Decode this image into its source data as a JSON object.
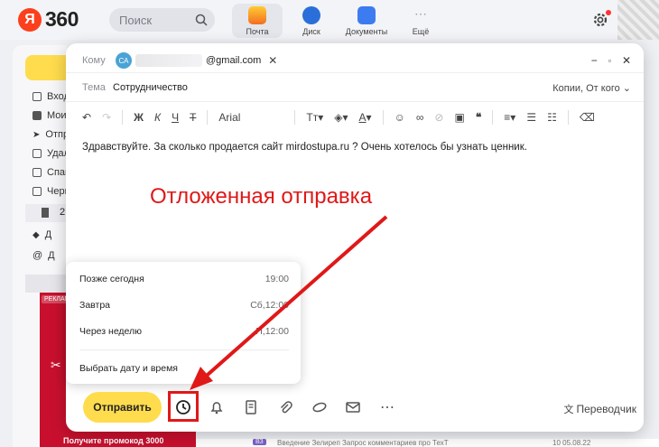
{
  "header": {
    "logo_ya": "Я",
    "logo_360": "360",
    "search_placeholder": "Поиск",
    "apps": [
      {
        "label": "Почта",
        "color": "#f6a123"
      },
      {
        "label": "Диск",
        "color": "#2a6fd9"
      },
      {
        "label": "Документы",
        "color": "#3d7cf0"
      },
      {
        "label": "Ещё",
        "color": "#9aa0aa"
      }
    ],
    "icons": {
      "search": "search-icon",
      "settings": "gear-icon"
    }
  },
  "sidebar": {
    "items": [
      "Вход",
      "Мои",
      "Отпр",
      "Удал",
      "Спам",
      "Черн"
    ],
    "folder_count": "2",
    "labels": [
      "Д",
      "Д"
    ],
    "ad_label": "РЕКЛАМА",
    "ad_text": "Получите промокод 3000"
  },
  "compose": {
    "to_label": "Кому",
    "recipient_initials": "СА",
    "recipient_email": "@gmail.com",
    "subject_label": "Тема",
    "subject": "Сотрудничество",
    "copies": "Копии, От кого",
    "font": "Arial",
    "body": "Здравствуйте. За сколько продается сайт mirdostupa.ru ? Очень хотелось бы узнать ценник.",
    "send_label": "Отправить",
    "translator_label": "Переводчик"
  },
  "schedule": {
    "options": [
      {
        "label": "Позже сегодня",
        "time": "19:00"
      },
      {
        "label": "Завтра",
        "time": "Сб,12:00"
      },
      {
        "label": "Через неделю",
        "time": "П,12:00"
      }
    ],
    "custom_label": "Выбрать дату и время"
  },
  "annotation": {
    "text": "Отложенная отправка",
    "color": "#e01818"
  },
  "background_row": {
    "badge": "ВЗ",
    "text": "Введение Зелиреп   Запрос комментариев про ТехТ",
    "date": "10  05.08.22"
  }
}
